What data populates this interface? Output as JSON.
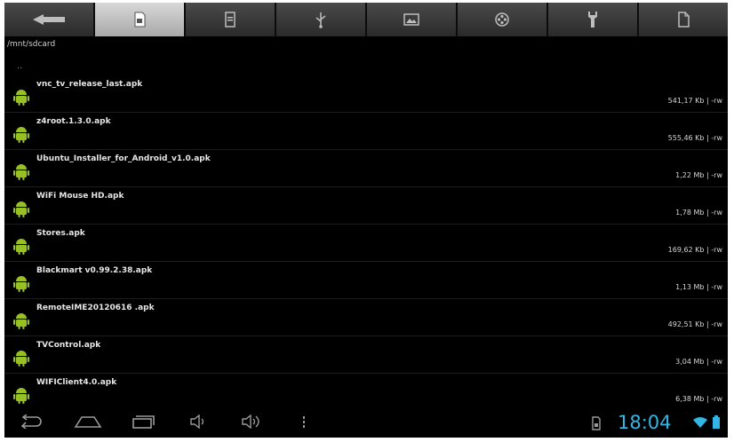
{
  "toolbar": {
    "buttons": [
      {
        "name": "back",
        "icon": "back-arrow-icon"
      },
      {
        "name": "sdcard",
        "icon": "sdcard-icon",
        "active": true
      },
      {
        "name": "internal",
        "icon": "internal-storage-icon"
      },
      {
        "name": "usb",
        "icon": "usb-icon"
      },
      {
        "name": "image",
        "icon": "image-icon"
      },
      {
        "name": "media",
        "icon": "film-reel-icon"
      },
      {
        "name": "tools",
        "icon": "wrench-icon"
      },
      {
        "name": "new-file",
        "icon": "new-file-icon"
      }
    ]
  },
  "path": "/mnt/sdcard",
  "parent_dir": "..",
  "files": [
    {
      "name": "vnc_tv_release_last.apk",
      "meta": "541,17 Kb | -rw"
    },
    {
      "name": "z4root.1.3.0.apk",
      "meta": "555,46 Kb | -rw"
    },
    {
      "name": "Ubuntu_Installer_for_Android_v1.0.apk",
      "meta": "1,22 Mb | -rw"
    },
    {
      "name": "WiFi Mouse HD.apk",
      "meta": "1,78 Mb | -rw"
    },
    {
      "name": "Stores.apk",
      "meta": "169,62 Kb | -rw"
    },
    {
      "name": "Blackmart v0.99.2.38.apk",
      "meta": "1,13 Mb | -rw"
    },
    {
      "name": "RemoteIME20120616 .apk",
      "meta": "492,51 Kb | -rw"
    },
    {
      "name": "TVControl.apk",
      "meta": "3,04 Mb | -rw"
    },
    {
      "name": "WIFIClient4.0.apk",
      "meta": "6,38 Mb | -rw"
    }
  ],
  "navbar": {
    "clock": "18:04",
    "accent_color": "#33b5e5"
  },
  "colors": {
    "android_green": "#97c024",
    "toolbar_active": "#c8c8c8",
    "toolbar_inactive": "#3a3a3a"
  }
}
